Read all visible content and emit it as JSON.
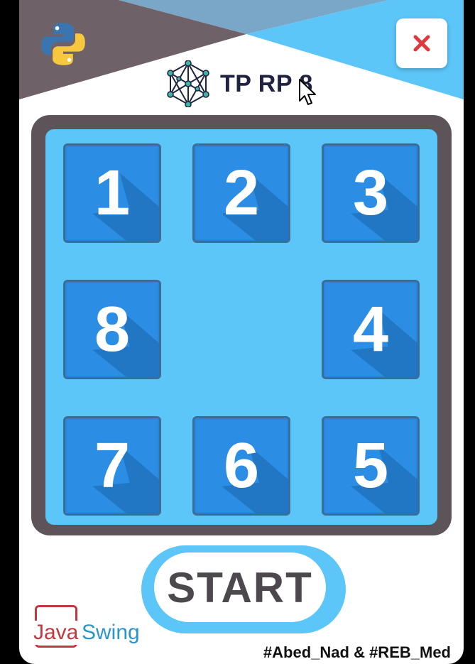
{
  "title": "TP RP 8",
  "close_symbol": "×",
  "tiles": [
    {
      "label": "1",
      "row": 0,
      "col": 0
    },
    {
      "label": "2",
      "row": 0,
      "col": 1
    },
    {
      "label": "3",
      "row": 0,
      "col": 2
    },
    {
      "label": "8",
      "row": 1,
      "col": 0
    },
    {
      "label": "4",
      "row": 1,
      "col": 2
    },
    {
      "label": "7",
      "row": 2,
      "col": 0
    },
    {
      "label": "6",
      "row": 2,
      "col": 1
    },
    {
      "label": "5",
      "row": 2,
      "col": 2
    }
  ],
  "empty_cell": {
    "row": 1,
    "col": 1
  },
  "start_label": "START",
  "logo": {
    "java": "Java",
    "swing": "Swing"
  },
  "credit": "#Abed_Nad & #REB_Med",
  "colors": {
    "board_frame": "#5d5459",
    "board_fill": "#5cc6f8",
    "tile": "#2b8ee4",
    "accent": "#e03a3e"
  }
}
